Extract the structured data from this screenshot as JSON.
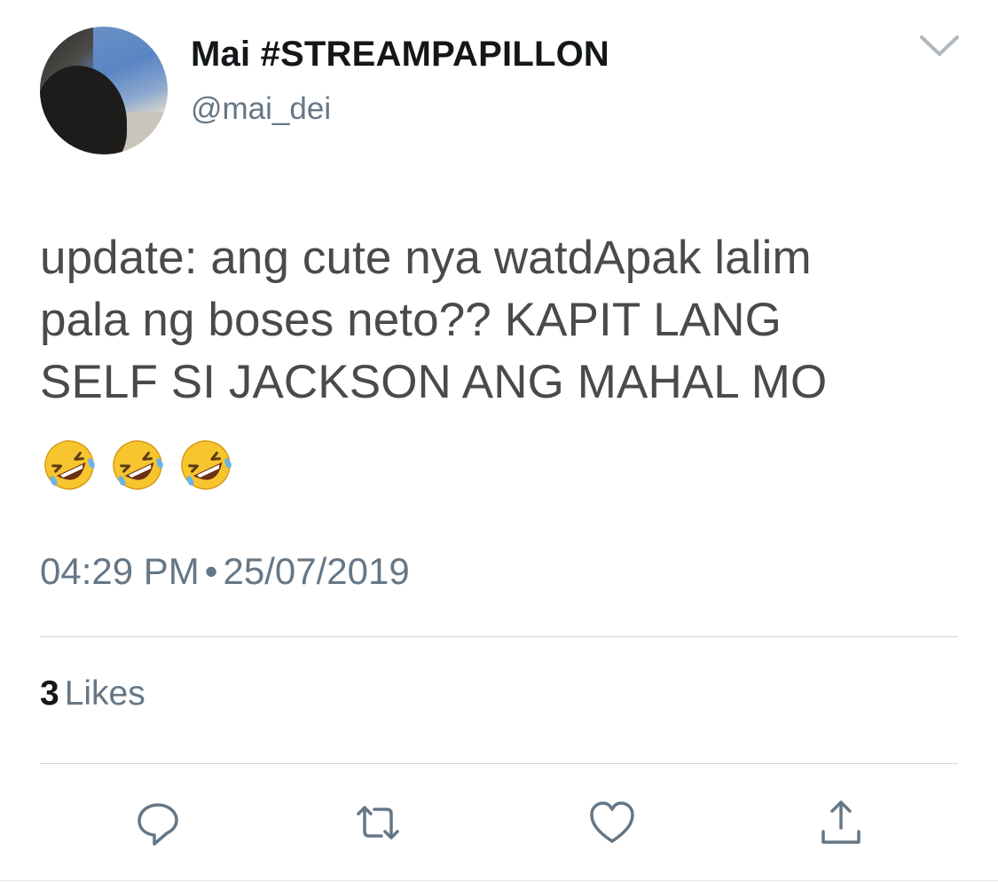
{
  "tweet": {
    "display_name": "Mai #STREAMPAPILLON",
    "handle": "@mai_dei",
    "text_lines": [
      "update: ang cute nya watdApak lalim",
      "pala ng boses neto?? KAPIT LANG",
      "SELF SI JACKSON ANG MAHAL MO"
    ],
    "emojis": [
      "🤣",
      "🤣",
      "🤣"
    ],
    "time": "04:29 PM",
    "separator": "•",
    "date": "25/07/2019",
    "likes_count": "3",
    "likes_label": "Likes"
  },
  "icons": {
    "menu": "chevron-down-icon",
    "reply": "reply-icon",
    "retweet": "retweet-icon",
    "like": "heart-icon",
    "share": "share-icon"
  },
  "colors": {
    "text_primary": "#14171a",
    "text_secondary": "#657786",
    "body_text": "#4a4a4a",
    "divider": "#cfd5d9"
  }
}
